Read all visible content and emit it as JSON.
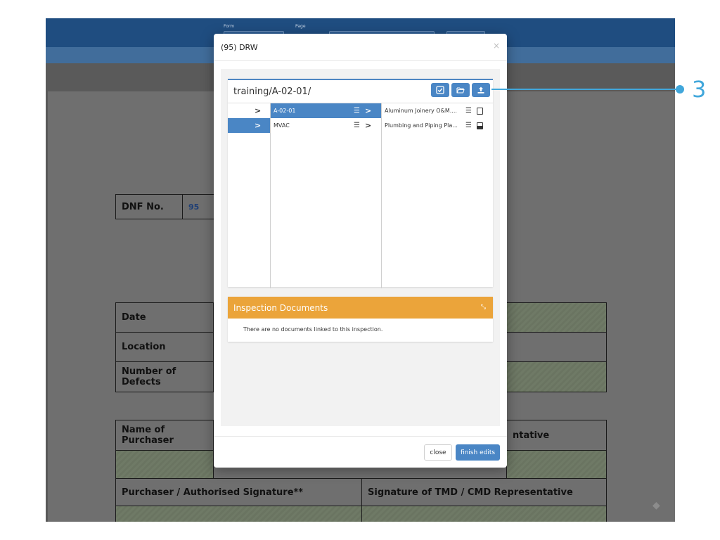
{
  "app": {
    "topbar": {
      "form_label": "Form",
      "page_label": "Page"
    },
    "form": {
      "dnf_label": "DNF No.",
      "dnf_value": "95",
      "date_label": "Date",
      "location_label": "Location",
      "defects_label": "Number of Defects",
      "purchaser_name_label": "Name of Purchaser",
      "representative_label": "ntative",
      "purchaser_signature_label": "Purchaser / Authorised Signature**",
      "tmd_signature_label": "Signature of TMD / CMD Representative"
    }
  },
  "modal": {
    "title": "(95) DRW",
    "close_symbol": "×",
    "browser": {
      "path": "training/A-02-01/",
      "buttons": [
        "check-square-icon",
        "folder-open-icon",
        "upload-icon"
      ],
      "column1": [
        {
          "arrow": ">",
          "selected": false
        },
        {
          "arrow": ">",
          "selected": true
        }
      ],
      "column2": [
        {
          "label": "A-02-01",
          "selected": true
        },
        {
          "label": "MVAC",
          "selected": false
        }
      ],
      "column3": [
        {
          "label": "Aluminum Joinery O&M....",
          "file_icon": "pdf-file-icon"
        },
        {
          "label": "Plumbing and Piping Pla...",
          "file_icon": "image-file-icon"
        }
      ]
    },
    "inspection": {
      "title": "Inspection Documents",
      "empty_message": "There are no documents linked to this inspection."
    },
    "footer": {
      "close_label": "close",
      "finish_label": "finish edits"
    }
  },
  "callout": {
    "number": "3",
    "color": "#41a7db"
  },
  "colors": {
    "accent": "#4a86c5",
    "inspection_header": "#eba43a",
    "topbar": "#1f4d80"
  }
}
